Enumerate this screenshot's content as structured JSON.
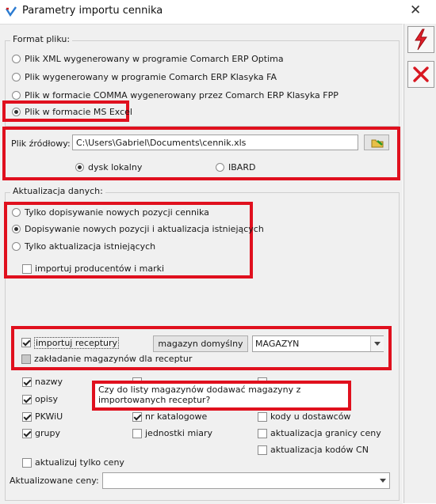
{
  "window": {
    "title": "Parametry importu cennika",
    "close_label": "✕"
  },
  "format": {
    "legend": "Format pliku:",
    "options": [
      {
        "label": "Plik XML wygenerowany w programie Comarch ERP Optima",
        "selected": false
      },
      {
        "label": "Plik wygenerowany w programie Comarch ERP Klasyka FA",
        "selected": false
      },
      {
        "label": "Plik w formacie COMMA wygenerowany przez Comarch ERP Klasyka FPP",
        "selected": false
      },
      {
        "label": "Plik w formacie MS Excel",
        "selected": true
      }
    ]
  },
  "source": {
    "label": "Plik źródłowy:",
    "path": "C:\\Users\\Gabriel\\Documents\\cennik.xls",
    "local_label": "dysk lokalny",
    "local_selected": true,
    "ibard_label": "IBARD",
    "ibard_selected": false
  },
  "update": {
    "legend": "Aktualizacja danych:",
    "options": [
      {
        "label": "Tylko dopisywanie nowych pozycji cennika",
        "selected": false
      },
      {
        "label": "Dopisywanie nowych pozycji i aktualizacja istniejących",
        "selected": true
      },
      {
        "label": "Tylko aktualizacja istniejących",
        "selected": false
      }
    ],
    "producers_label": "importuj producentów i marki",
    "producers_checked": false
  },
  "recipes": {
    "import_label": "importuj receptury",
    "import_checked": true,
    "warehouse_button": "magazyn domyślny",
    "warehouse_value": "MAGAZYN",
    "create_label": "zakładanie magazynów dla receptur",
    "create_checked": false
  },
  "tooltip": {
    "text": "Czy do listy magazynów dodawać magazyny z importowanych receptur?"
  },
  "fields": {
    "nazwy": "nazwy",
    "opisy": "opisy",
    "pkwiu": "PKWiU",
    "nr_katalogowe": "nr katalogowe",
    "kody_u_dostawcow": "kody u dostawców",
    "grupy": "grupy",
    "jednostki_miary": "jednostki miary",
    "aktualizacja_granicy_ceny": "aktualizacja granicy ceny",
    "aktualizacja_kodow_cn": "aktualizacja kodów CN"
  },
  "prices": {
    "only_prices_label": "aktualizuj tylko ceny",
    "updated_prices_label": "Aktualizowane ceny:",
    "updated_prices_value": ""
  }
}
